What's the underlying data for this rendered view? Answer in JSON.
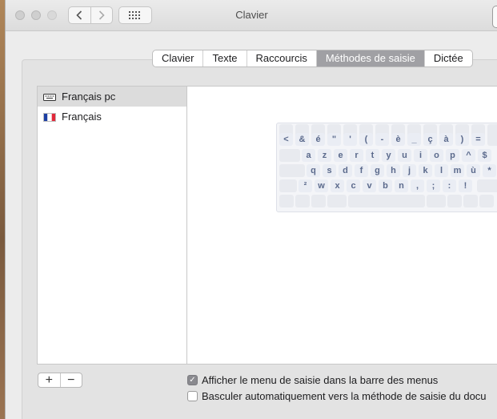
{
  "window": {
    "title": "Clavier"
  },
  "tabs": [
    "Clavier",
    "Texte",
    "Raccourcis",
    "Méthodes de saisie",
    "Dictée"
  ],
  "active_tab": "Méthodes de saisie",
  "input_sources": [
    {
      "label": "Français pc",
      "icon": "keyboard-icon",
      "selected": true
    },
    {
      "label": "Français",
      "icon": "french-flag-icon",
      "selected": false
    }
  ],
  "keyboard_rows": [
    [
      "<",
      "&",
      "é",
      "\"",
      "'",
      "(",
      "-",
      "è",
      "_",
      "ç",
      "à",
      ")",
      "="
    ],
    [
      "a",
      "z",
      "e",
      "r",
      "t",
      "y",
      "u",
      "i",
      "o",
      "p",
      "^",
      "$"
    ],
    [
      "q",
      "s",
      "d",
      "f",
      "g",
      "h",
      "j",
      "k",
      "l",
      "m",
      "ù",
      "*"
    ],
    [
      "²",
      "w",
      "x",
      "c",
      "v",
      "b",
      "n",
      ",",
      ";",
      ":",
      "!"
    ]
  ],
  "buttons": {
    "add": "+",
    "remove": "−"
  },
  "options": [
    {
      "label": "Afficher le menu de saisie dans la barre des menus",
      "checked": true
    },
    {
      "label": "Basculer automatiquement vers la méthode de saisie du docu",
      "checked": false
    }
  ],
  "colors": {
    "active_tab": "#a0a0a4",
    "key_text": "#5b6a8c",
    "selection": "#dcdcdc"
  }
}
